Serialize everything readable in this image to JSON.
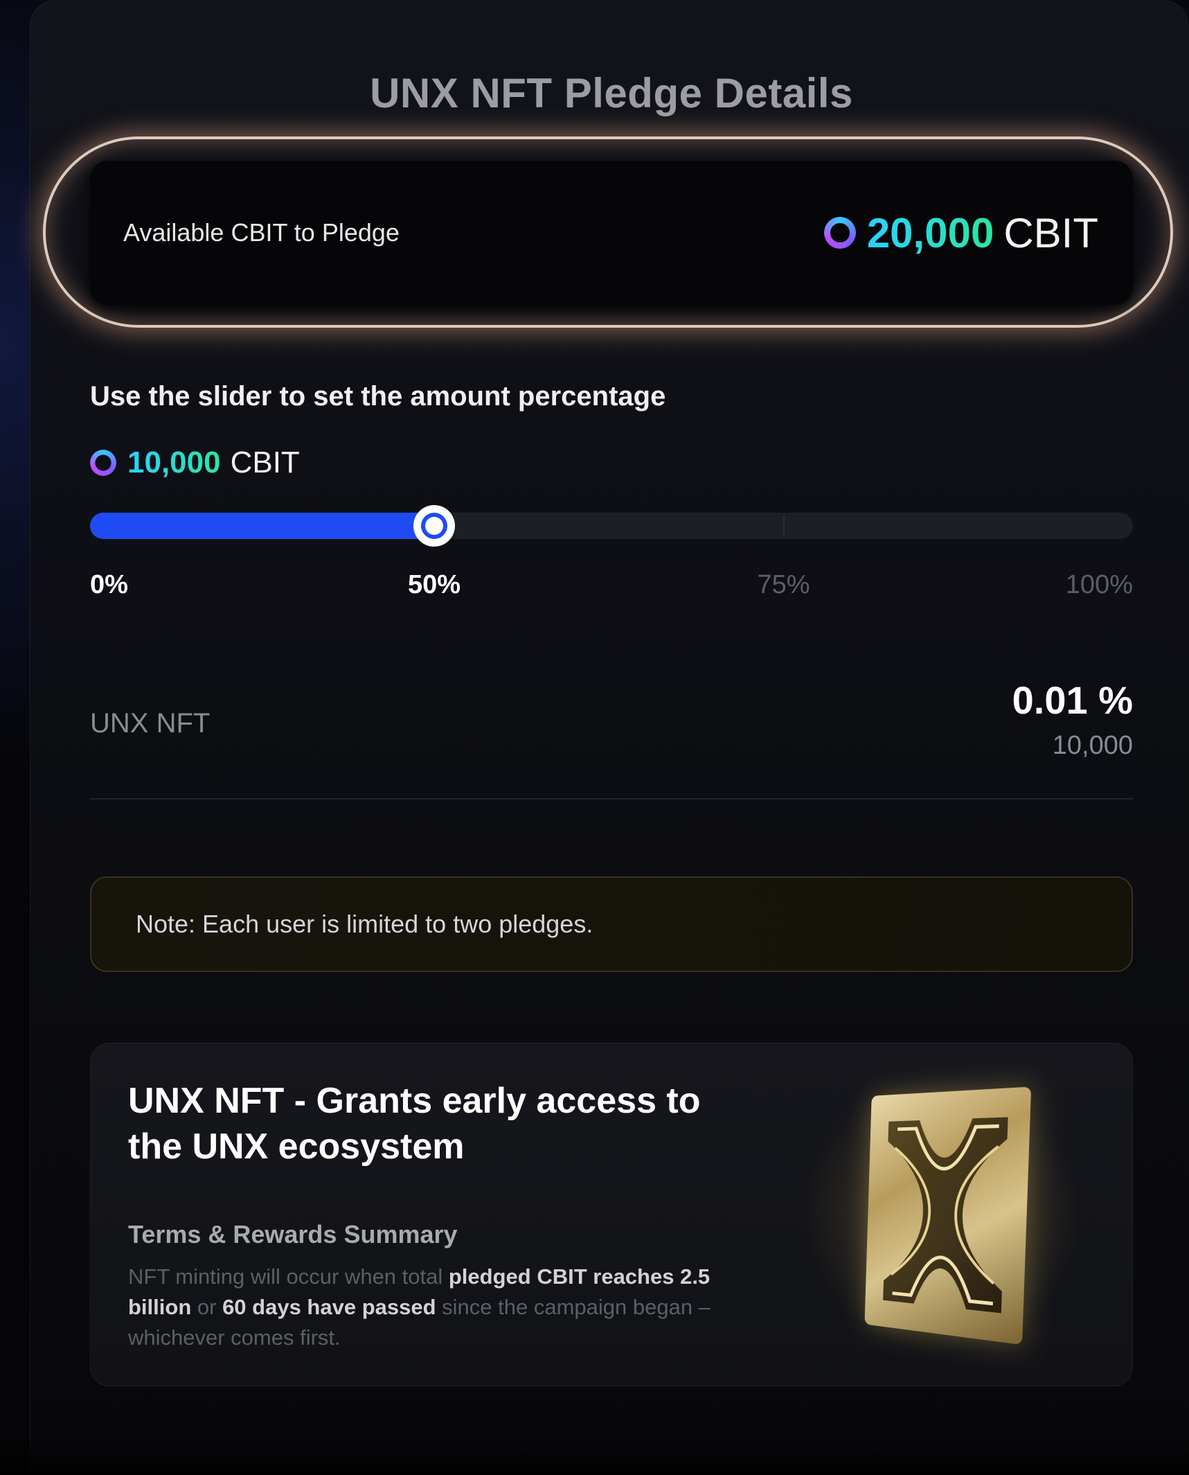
{
  "title": "UNX NFT Pledge Details",
  "available": {
    "label": "Available CBIT to Pledge",
    "amount": "20,000",
    "unit": "CBIT",
    "icon": "cbit-coin-icon"
  },
  "slider": {
    "hint": "Use the slider to set the amount percentage",
    "selected_amount": "10,000",
    "selected_unit": "CBIT",
    "value_percent": 33,
    "marks": [
      {
        "label": "0%",
        "percent": 0,
        "active": true
      },
      {
        "label": "50%",
        "percent": 33,
        "active": true
      },
      {
        "label": "75%",
        "percent": 66.5,
        "active": false
      },
      {
        "label": "100%",
        "percent": 100,
        "active": false
      }
    ]
  },
  "nft": {
    "label": "UNX NFT",
    "percent": "0.01 %",
    "count": "10,000"
  },
  "note": "Note: Each user is limited to two pledges.",
  "promo": {
    "title": "UNX NFT - Grants early access to the UNX ecosystem",
    "subtitle": "Terms & Rewards Summary",
    "desc_1": "NFT minting will occur when total ",
    "desc_bold_1": "pledged CBIT reaches 2.5 billion",
    "desc_2": " or ",
    "desc_bold_2": "60 days have passed",
    "desc_3": " since the campaign began – whichever comes first.",
    "image_icon": "unx-nft-card-icon"
  },
  "colors": {
    "accent_blue": "#1f4bf2",
    "amount_gradient_start": "#2ad1ff",
    "amount_gradient_end": "#2ae6a0",
    "glow": "#e6aa82",
    "note_border": "#3a3220"
  }
}
